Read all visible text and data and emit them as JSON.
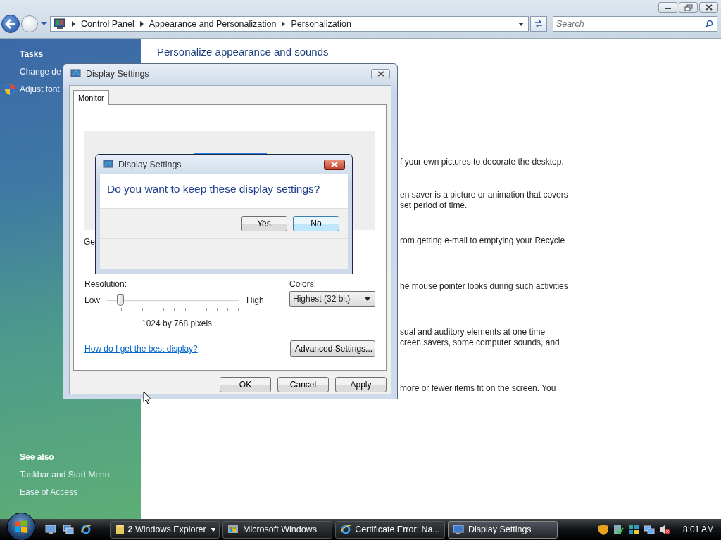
{
  "explorer": {
    "breadcrumb": [
      "Control Panel",
      "Appearance and Personalization",
      "Personalization"
    ],
    "search": {
      "placeholder": "Search"
    }
  },
  "sidebar": {
    "tasks_heading": "Tasks",
    "tasks": [
      {
        "label": "Change de",
        "shield": false
      },
      {
        "label": "Adjust font",
        "shield": true
      }
    ],
    "see_also_heading": "See also",
    "see_also": [
      "Taskbar and Start Menu",
      "Ease of Access"
    ]
  },
  "content": {
    "heading": "Personalize appearance and sounds",
    "fragments": [
      [
        "f your own pictures to decorate the desktop."
      ],
      [
        "en saver is a picture or animation that covers",
        "set period of time."
      ],
      [
        "rom getting e-mail to emptying your Recycle"
      ],
      [
        "he mouse pointer looks during such activities"
      ],
      [
        "sual and auditory elements at one time",
        "creen savers, some computer sounds, and"
      ],
      [
        "more or fewer items fit on the screen. You"
      ]
    ]
  },
  "display_settings": {
    "title": "Display Settings",
    "tabs": [
      {
        "label": "Monitor",
        "selected": true
      }
    ],
    "partial_label": "Ge",
    "resolution_label": "Resolution:",
    "slider": {
      "low": "Low",
      "high": "High",
      "level": 0.1
    },
    "resolution_reading": "1024 by 768 pixels",
    "colors_label": "Colors:",
    "colors_value": "Highest (32 bit)",
    "help_link": "How do I get the best display?",
    "advanced_button": "Advanced Settings...",
    "buttons": [
      "OK",
      "Cancel",
      "Apply"
    ]
  },
  "confirm": {
    "title": "Display Settings",
    "question": "Do you want to keep these display settings?",
    "buttons": [
      {
        "label": "Yes",
        "default": false
      },
      {
        "label": "No",
        "default": true
      }
    ]
  },
  "taskbar": {
    "tasks": [
      {
        "label": "**2** Windows Explorer",
        "kind": "folder",
        "grouped": true,
        "selected": false
      },
      {
        "label": "Microsoft Windows",
        "kind": "windows",
        "grouped": false,
        "selected": false
      },
      {
        "label": "Certificate Error: Na...",
        "kind": "ie",
        "grouped": false,
        "selected": false
      },
      {
        "label": "Display Settings",
        "kind": "monitor",
        "grouped": false,
        "selected": true
      }
    ],
    "clock": "8:01 AM"
  }
}
